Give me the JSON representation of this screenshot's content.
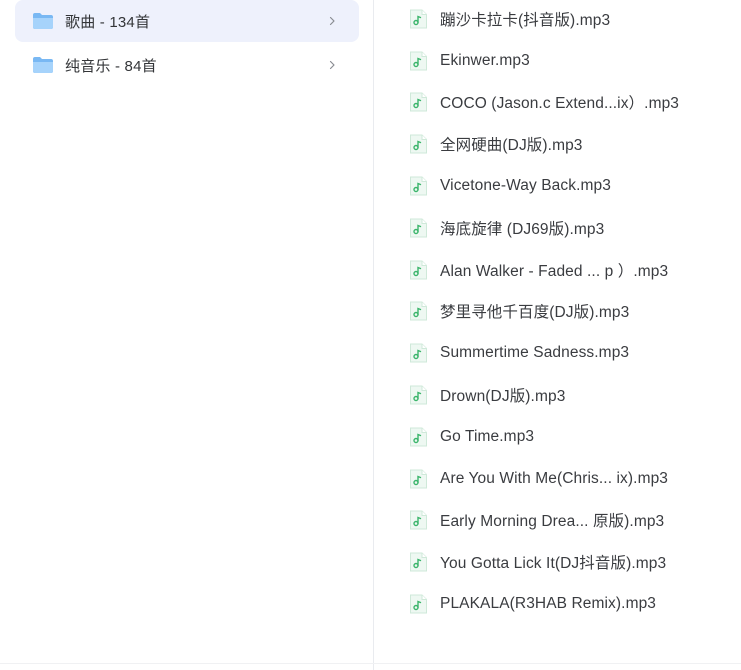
{
  "folders": [
    {
      "label": "歌曲 - 134首",
      "selected": true
    },
    {
      "label": "纯音乐 - 84首",
      "selected": false
    }
  ],
  "files": [
    {
      "name": "蹦沙卡拉卡(抖音版).mp3"
    },
    {
      "name": "Ekinwer.mp3"
    },
    {
      "name": "COCO (Jason.c Extend...ix）.mp3"
    },
    {
      "name": "全网硬曲(DJ版).mp3"
    },
    {
      "name": "Vicetone-Way Back.mp3"
    },
    {
      "name": "海底旋律 (DJ69版).mp3"
    },
    {
      "name": "Alan Walker - Faded ... p ）.mp3"
    },
    {
      "name": "梦里寻他千百度(DJ版).mp3"
    },
    {
      "name": "Summertime Sadness.mp3"
    },
    {
      "name": "Drown(DJ版).mp3"
    },
    {
      "name": "Go Time.mp3"
    },
    {
      "name": "Are You With Me(Chris... ix).mp3"
    },
    {
      "name": "Early Morning Drea... 原版).mp3"
    },
    {
      "name": "You Gotta Lick It(DJ抖音版).mp3"
    },
    {
      "name": "PLAKALA(R3HAB Remix).mp3"
    }
  ],
  "icons": {
    "folder": "folder-icon",
    "music_file": "music-file-icon",
    "chevron": "chevron-right-icon"
  },
  "colors": {
    "selected_bg": "#eef1fc",
    "folder_blue": "#8ec5f5",
    "music_green": "#3bb56b"
  }
}
